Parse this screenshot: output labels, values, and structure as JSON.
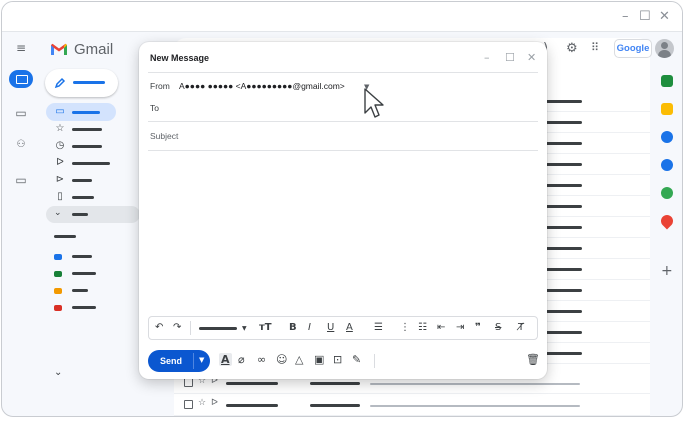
{
  "window": {
    "minimize": "–",
    "maximize": "☐",
    "close": "✕"
  },
  "app": {
    "name": "Gmail",
    "menu_icon": "hamburger-icon"
  },
  "rail": {
    "icons": [
      "mail-icon",
      "chat-icon",
      "spaces-icon",
      "meet-icon"
    ]
  },
  "header": {
    "google_badge": "Google",
    "icons": [
      "help-icon",
      "settings-icon",
      "apps-grid-icon"
    ]
  },
  "labels": {
    "colors": [
      "#1a73e8",
      "#188038",
      "#f29900",
      "#d93025"
    ]
  },
  "compose": {
    "title": "New Message",
    "from_label": "From",
    "from_value": "A●●●● ●●●●● <A●●●●●●●●●@gmail.com>",
    "to_label": "To",
    "subject_placeholder": "Subject",
    "send_label": "Send",
    "controls": [
      "minimize-icon",
      "popout-icon",
      "close-icon"
    ],
    "format_tools": [
      "undo",
      "redo",
      "font",
      "text-size",
      "bold",
      "italic",
      "underline",
      "text-color",
      "align",
      "numbered-list",
      "bulleted-list",
      "indent-less",
      "indent-more",
      "quote",
      "strikethrough",
      "clear-formatting"
    ],
    "bottom_tools": [
      "formatting",
      "attach",
      "link",
      "emoji",
      "drive",
      "photo",
      "lock",
      "signature",
      "trash"
    ]
  },
  "colors": {
    "accent": "#0b57d0",
    "selected_nav": "#d3e3fd"
  }
}
